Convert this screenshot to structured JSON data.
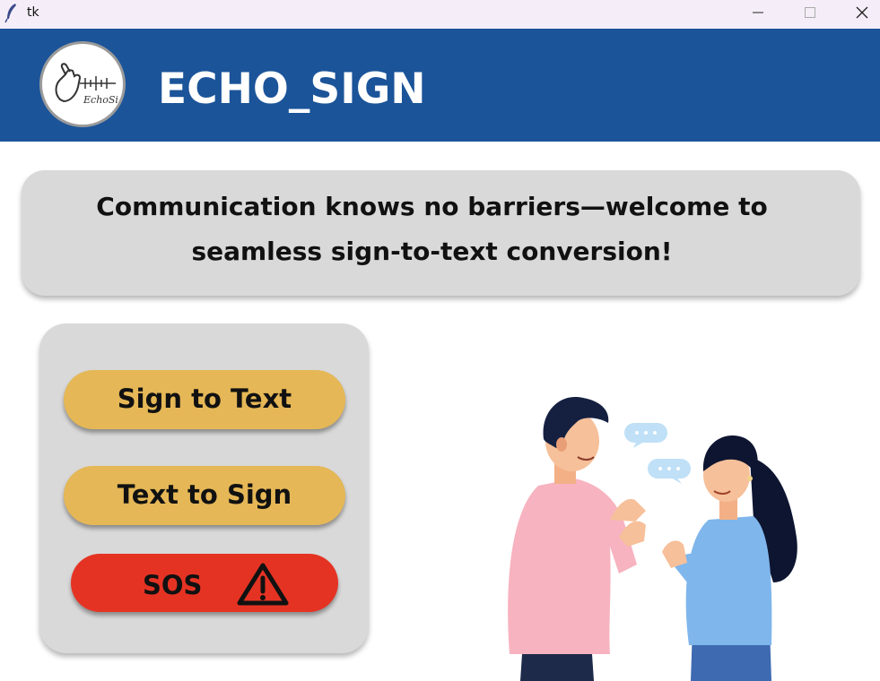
{
  "window": {
    "title": "tk",
    "app_icon": "feather-icon",
    "controls": [
      "minimize-icon",
      "maximize-icon",
      "close-icon"
    ]
  },
  "header": {
    "logo_text": "EchoSign",
    "title": "ECHO_SIGN",
    "background": "#1b5499"
  },
  "banner": {
    "line1": "Communication knows no barriers—welcome to",
    "line2": "seamless sign-to-text conversion!"
  },
  "actions": {
    "sign_to_text": "Sign to Text",
    "text_to_sign": "Text to Sign",
    "sos": "SOS",
    "sos_icon": "warning-icon",
    "primary_color": "#e5b756",
    "danger_color": "#e53323"
  },
  "illustration": {
    "icon": "people-signing-illustration"
  }
}
